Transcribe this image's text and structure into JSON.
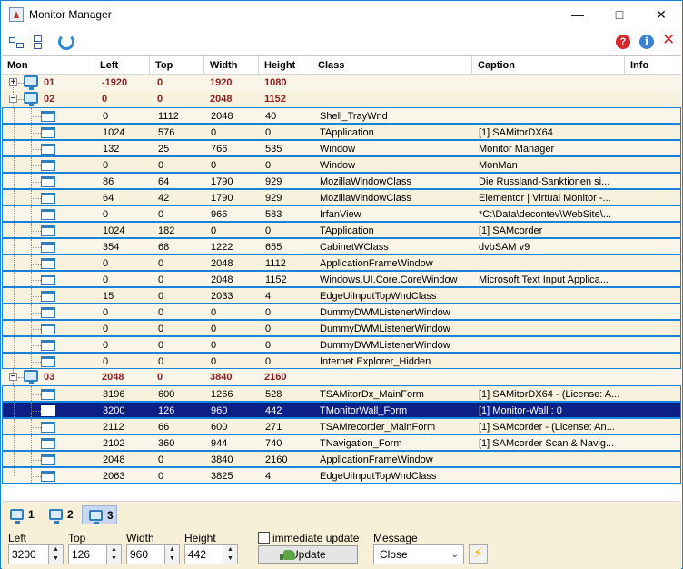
{
  "window": {
    "title": "Monitor Manager",
    "controls": [
      "—",
      "□",
      "✕"
    ]
  },
  "toolbar": {
    "expand_tree_icon": "tree-expand-icon",
    "collapse_tree_icon": "tree-collapse-icon",
    "refresh_icon": "refresh-icon",
    "help_icon_text": "?",
    "info_icon_text": "i",
    "close_icon_text": "✕"
  },
  "grid": {
    "columns": [
      "Mon",
      "Left",
      "Top",
      "Width",
      "Height",
      "Class",
      "Caption",
      "Info"
    ],
    "rows": [
      {
        "type": "monitor",
        "expander": "+",
        "mon": "01",
        "left": "-1920",
        "top": "0",
        "width": "1920",
        "height": "1080",
        "class": "",
        "caption": "",
        "info": ""
      },
      {
        "type": "monitor",
        "expander": "−",
        "mon": "02",
        "left": "0",
        "top": "0",
        "width": "2048",
        "height": "1152",
        "class": "",
        "caption": "",
        "info": ""
      },
      {
        "type": "window",
        "mon": "",
        "left": "0",
        "top": "1112",
        "width": "2048",
        "height": "40",
        "class": "Shell_TrayWnd",
        "caption": "",
        "info": ""
      },
      {
        "type": "window",
        "mon": "",
        "left": "1024",
        "top": "576",
        "width": "0",
        "height": "0",
        "class": "TApplication",
        "caption": "[1] SAMitorDX64",
        "info": ""
      },
      {
        "type": "window",
        "mon": "",
        "left": "132",
        "top": "25",
        "width": "766",
        "height": "535",
        "class": "Window",
        "caption": "Monitor Manager",
        "info": ""
      },
      {
        "type": "window",
        "mon": "",
        "left": "0",
        "top": "0",
        "width": "0",
        "height": "0",
        "class": "Window",
        "caption": "MonMan",
        "info": ""
      },
      {
        "type": "window",
        "mon": "",
        "left": "86",
        "top": "64",
        "width": "1790",
        "height": "929",
        "class": "MozillaWindowClass",
        "caption": "Die Russland-Sanktionen si...",
        "info": ""
      },
      {
        "type": "window",
        "mon": "",
        "left": "64",
        "top": "42",
        "width": "1790",
        "height": "929",
        "class": "MozillaWindowClass",
        "caption": "Elementor | Virtual Monitor -...",
        "info": ""
      },
      {
        "type": "window",
        "mon": "",
        "left": "0",
        "top": "0",
        "width": "966",
        "height": "583",
        "class": "IrfanView",
        "caption": "*C:\\Data\\decontev\\WebSite\\...",
        "info": ""
      },
      {
        "type": "window",
        "mon": "",
        "left": "1024",
        "top": "182",
        "width": "0",
        "height": "0",
        "class": "TApplication",
        "caption": "[1] SAMcorder",
        "info": ""
      },
      {
        "type": "window",
        "mon": "",
        "left": "354",
        "top": "68",
        "width": "1222",
        "height": "655",
        "class": "CabinetWClass",
        "caption": "dvbSAM v9",
        "info": ""
      },
      {
        "type": "window",
        "mon": "",
        "left": "0",
        "top": "0",
        "width": "2048",
        "height": "1112",
        "class": "ApplicationFrameWindow",
        "caption": "",
        "info": ""
      },
      {
        "type": "window",
        "mon": "",
        "left": "0",
        "top": "0",
        "width": "2048",
        "height": "1152",
        "class": "Windows.UI.Core.CoreWindow",
        "caption": "Microsoft Text Input Applica...",
        "info": ""
      },
      {
        "type": "window",
        "mon": "",
        "left": "15",
        "top": "0",
        "width": "2033",
        "height": "4",
        "class": "EdgeUiInputTopWndClass",
        "caption": "",
        "info": ""
      },
      {
        "type": "window",
        "mon": "",
        "left": "0",
        "top": "0",
        "width": "0",
        "height": "0",
        "class": "DummyDWMListenerWindow",
        "caption": "",
        "info": ""
      },
      {
        "type": "window",
        "mon": "",
        "left": "0",
        "top": "0",
        "width": "0",
        "height": "0",
        "class": "DummyDWMListenerWindow",
        "caption": "",
        "info": ""
      },
      {
        "type": "window",
        "mon": "",
        "left": "0",
        "top": "0",
        "width": "0",
        "height": "0",
        "class": "DummyDWMListenerWindow",
        "caption": "",
        "info": ""
      },
      {
        "type": "window",
        "mon": "",
        "left": "0",
        "top": "0",
        "width": "0",
        "height": "0",
        "class": "Internet Explorer_Hidden",
        "caption": "",
        "info": ""
      },
      {
        "type": "monitor",
        "expander": "−",
        "mon": "03",
        "left": "2048",
        "top": "0",
        "width": "3840",
        "height": "2160",
        "class": "",
        "caption": "",
        "info": ""
      },
      {
        "type": "window",
        "mon": "",
        "left": "3196",
        "top": "600",
        "width": "1266",
        "height": "528",
        "class": "TSAMitorDx_MainForm",
        "caption": "[1] SAMitorDX64 - (License: A...",
        "info": ""
      },
      {
        "type": "window",
        "selected": true,
        "mon": "",
        "left": "3200",
        "top": "126",
        "width": "960",
        "height": "442",
        "class": "TMonitorWall_Form",
        "caption": "[1] Monitor-Wall : 0",
        "info": ""
      },
      {
        "type": "window",
        "mon": "",
        "left": "2112",
        "top": "66",
        "width": "600",
        "height": "271",
        "class": "TSAMrecorder_MainForm",
        "caption": "[1] SAMcorder - (License: An...",
        "info": ""
      },
      {
        "type": "window",
        "mon": "",
        "left": "2102",
        "top": "360",
        "width": "944",
        "height": "740",
        "class": "TNavigation_Form",
        "caption": "[1] SAMcorder Scan & Navig...",
        "info": ""
      },
      {
        "type": "window",
        "mon": "",
        "left": "2048",
        "top": "0",
        "width": "3840",
        "height": "2160",
        "class": "ApplicationFrameWindow",
        "caption": "",
        "info": ""
      },
      {
        "type": "window",
        "mon": "",
        "left": "2063",
        "top": "0",
        "width": "3825",
        "height": "4",
        "class": "EdgeUiInputTopWndClass",
        "caption": "",
        "info": ""
      }
    ]
  },
  "bottom": {
    "monitor_tabs": [
      "1",
      "2",
      "3"
    ],
    "selected_tab": "3",
    "left_label": "Left",
    "top_label": "Top",
    "width_label": "Width",
    "height_label": "Height",
    "left_value": "3200",
    "top_value": "126",
    "width_value": "960",
    "height_value": "442",
    "immediate_update_label": "immediate update",
    "update_button": "Update",
    "message_label": "Message",
    "message_value": "Close",
    "lightning_icon": "lightning-icon"
  }
}
